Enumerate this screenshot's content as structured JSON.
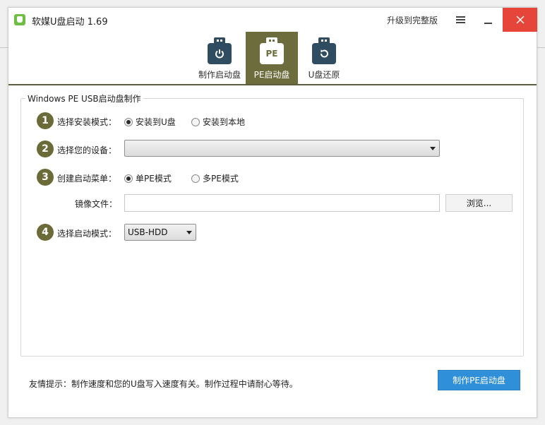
{
  "window": {
    "title": "软媒U盘启动 1.69",
    "upgrade_label": "升级到完整版"
  },
  "tabs": [
    {
      "label": "制作启动盘",
      "icon": "usb-power-icon",
      "active": false
    },
    {
      "label": "PE启动盘",
      "icon": "usb-pe-icon",
      "glyph": "PE",
      "active": true
    },
    {
      "label": "U盘还原",
      "icon": "usb-restore-icon",
      "active": false
    }
  ],
  "form": {
    "group_title": "Windows PE USB启动盘制作",
    "steps": [
      "1",
      "2",
      "3",
      "4"
    ],
    "install_mode_label": "选择安装模式：",
    "install_options": [
      {
        "label": "安装到U盘",
        "checked": true
      },
      {
        "label": "安装到本地",
        "checked": false
      }
    ],
    "device_label": "选择您的设备：",
    "device_value": "",
    "menu_label": "创建启动菜单：",
    "menu_options": [
      {
        "label": "单PE模式",
        "checked": true
      },
      {
        "label": "多PE模式",
        "checked": false
      }
    ],
    "image_label": "镜像文件：",
    "image_value": "",
    "browse_label": "浏览...",
    "boot_mode_label": "选择启动模式：",
    "boot_mode_value": "USB-HDD"
  },
  "footer": {
    "tip": "友情提示：制作速度和您的U盘写入速度有关。制作过程中请耐心等待。",
    "make_button": "制作PE启动盘"
  },
  "colors": {
    "accent_olive": "#6c6c3c",
    "close_red": "#e6463a",
    "primary_blue": "#2f8fd8",
    "usb_icon": "#2f4c60"
  }
}
